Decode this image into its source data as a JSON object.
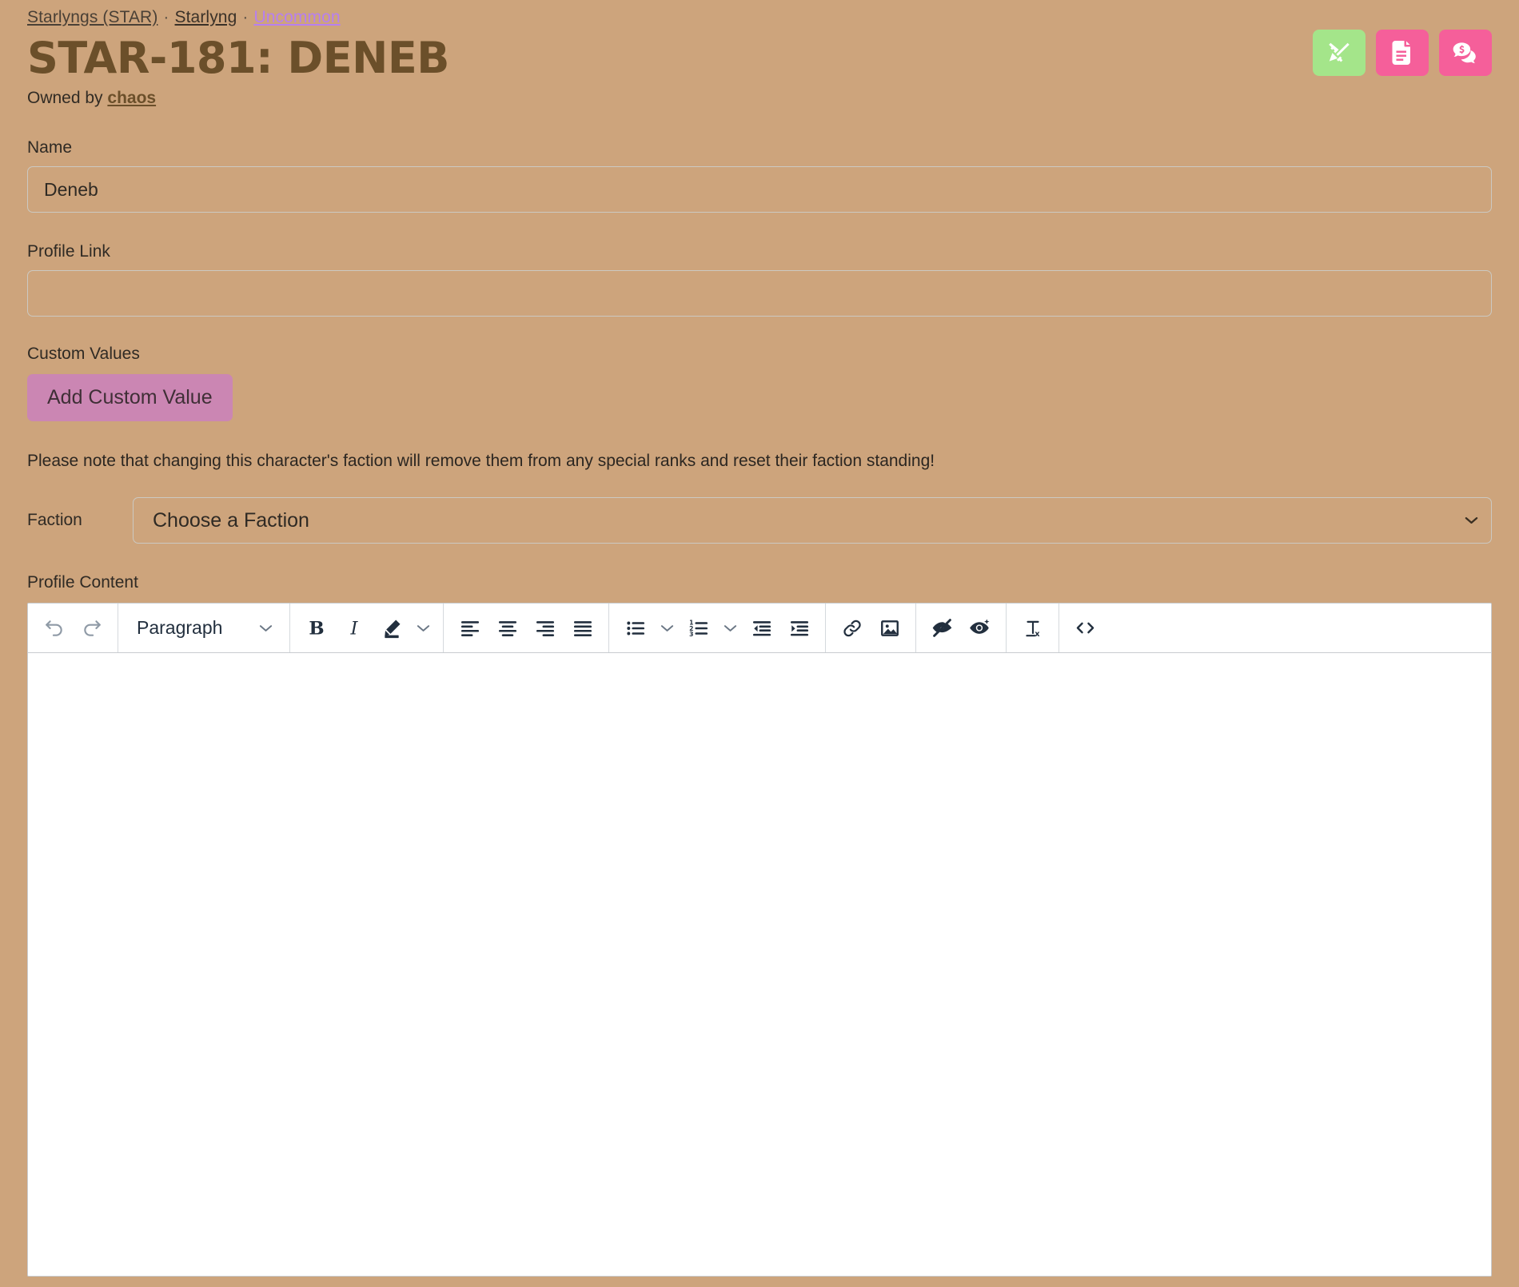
{
  "breadcrumb": {
    "category": "Starlyngs (STAR)",
    "species": "Starlyng",
    "rarity": "Uncommon",
    "separator": "·",
    "rarity_color": "#b77ff0"
  },
  "header": {
    "title": "STAR-181: DENEB",
    "owned_prefix": "Owned by ",
    "owner": "chaos",
    "title_color": "#6b4f2a"
  },
  "actions": [
    {
      "name": "design-button",
      "icon": "pencil-ruler-icon",
      "color": "#a4e58a",
      "label": "Design"
    },
    {
      "name": "document-button",
      "icon": "file-lines-icon",
      "color": "#f55f9a",
      "label": "Document"
    },
    {
      "name": "transfers-button",
      "icon": "comments-dollar-icon",
      "color": "#f55f9a",
      "label": "Transfers"
    }
  ],
  "form": {
    "name_label": "Name",
    "name_value": "Deneb",
    "name_placeholder": "",
    "profile_link_label": "Profile Link",
    "profile_link_value": "",
    "profile_link_placeholder": "",
    "custom_values_label": "Custom Values",
    "add_custom_value_button": "Add Custom Value",
    "faction_note": "Please note that changing this character's faction will remove them from any special ranks and reset their faction standing!",
    "faction_label": "Faction",
    "faction_selected": "Choose a Faction",
    "faction_options": [
      "Choose a Faction"
    ],
    "profile_content_label": "Profile Content"
  },
  "editor": {
    "content": "",
    "block_format": "Paragraph",
    "toolbar_groups": [
      {
        "name": "history",
        "items": [
          {
            "name": "undo-button",
            "icon": "undo-icon",
            "disabled": true
          },
          {
            "name": "redo-button",
            "icon": "redo-icon",
            "disabled": true
          }
        ]
      },
      {
        "name": "block-format",
        "items": [
          {
            "name": "block-format-select",
            "icon": "chevron-down-icon",
            "label": "Paragraph"
          }
        ]
      },
      {
        "name": "text-style",
        "items": [
          {
            "name": "bold-button",
            "icon": "bold-icon"
          },
          {
            "name": "italic-button",
            "icon": "italic-icon"
          },
          {
            "name": "text-color-button",
            "icon": "pen-highlight-icon"
          },
          {
            "name": "text-color-chevron",
            "icon": "chevron-down-icon"
          }
        ]
      },
      {
        "name": "alignment",
        "items": [
          {
            "name": "align-left-button",
            "icon": "align-left-icon"
          },
          {
            "name": "align-center-button",
            "icon": "align-center-icon"
          },
          {
            "name": "align-right-button",
            "icon": "align-right-icon"
          },
          {
            "name": "align-justify-button",
            "icon": "align-justify-icon"
          }
        ]
      },
      {
        "name": "lists",
        "items": [
          {
            "name": "bullet-list-button",
            "icon": "bullet-list-icon"
          },
          {
            "name": "bullet-list-chevron",
            "icon": "chevron-down-icon"
          },
          {
            "name": "numbered-list-button",
            "icon": "numbered-list-icon"
          },
          {
            "name": "numbered-list-chevron",
            "icon": "chevron-down-icon"
          },
          {
            "name": "outdent-button",
            "icon": "outdent-icon"
          },
          {
            "name": "indent-button",
            "icon": "indent-icon"
          }
        ]
      },
      {
        "name": "insert",
        "items": [
          {
            "name": "insert-link-button",
            "icon": "link-icon"
          },
          {
            "name": "insert-image-button",
            "icon": "image-icon"
          }
        ]
      },
      {
        "name": "visibility",
        "items": [
          {
            "name": "hide-spoiler-button",
            "icon": "eye-slash-icon"
          },
          {
            "name": "reveal-spoiler-button",
            "icon": "eye-sparkle-icon"
          }
        ]
      },
      {
        "name": "clear",
        "items": [
          {
            "name": "clear-formatting-button",
            "icon": "clear-formatting-icon"
          }
        ]
      },
      {
        "name": "source",
        "items": [
          {
            "name": "source-code-button",
            "icon": "code-icon"
          }
        ]
      }
    ]
  },
  "theme": {
    "background": "#cda47c",
    "accent_pink": "#f55f9a",
    "accent_green": "#a4e58a",
    "accent_purple": "#cb86b3",
    "border": "#ccc9c2"
  }
}
